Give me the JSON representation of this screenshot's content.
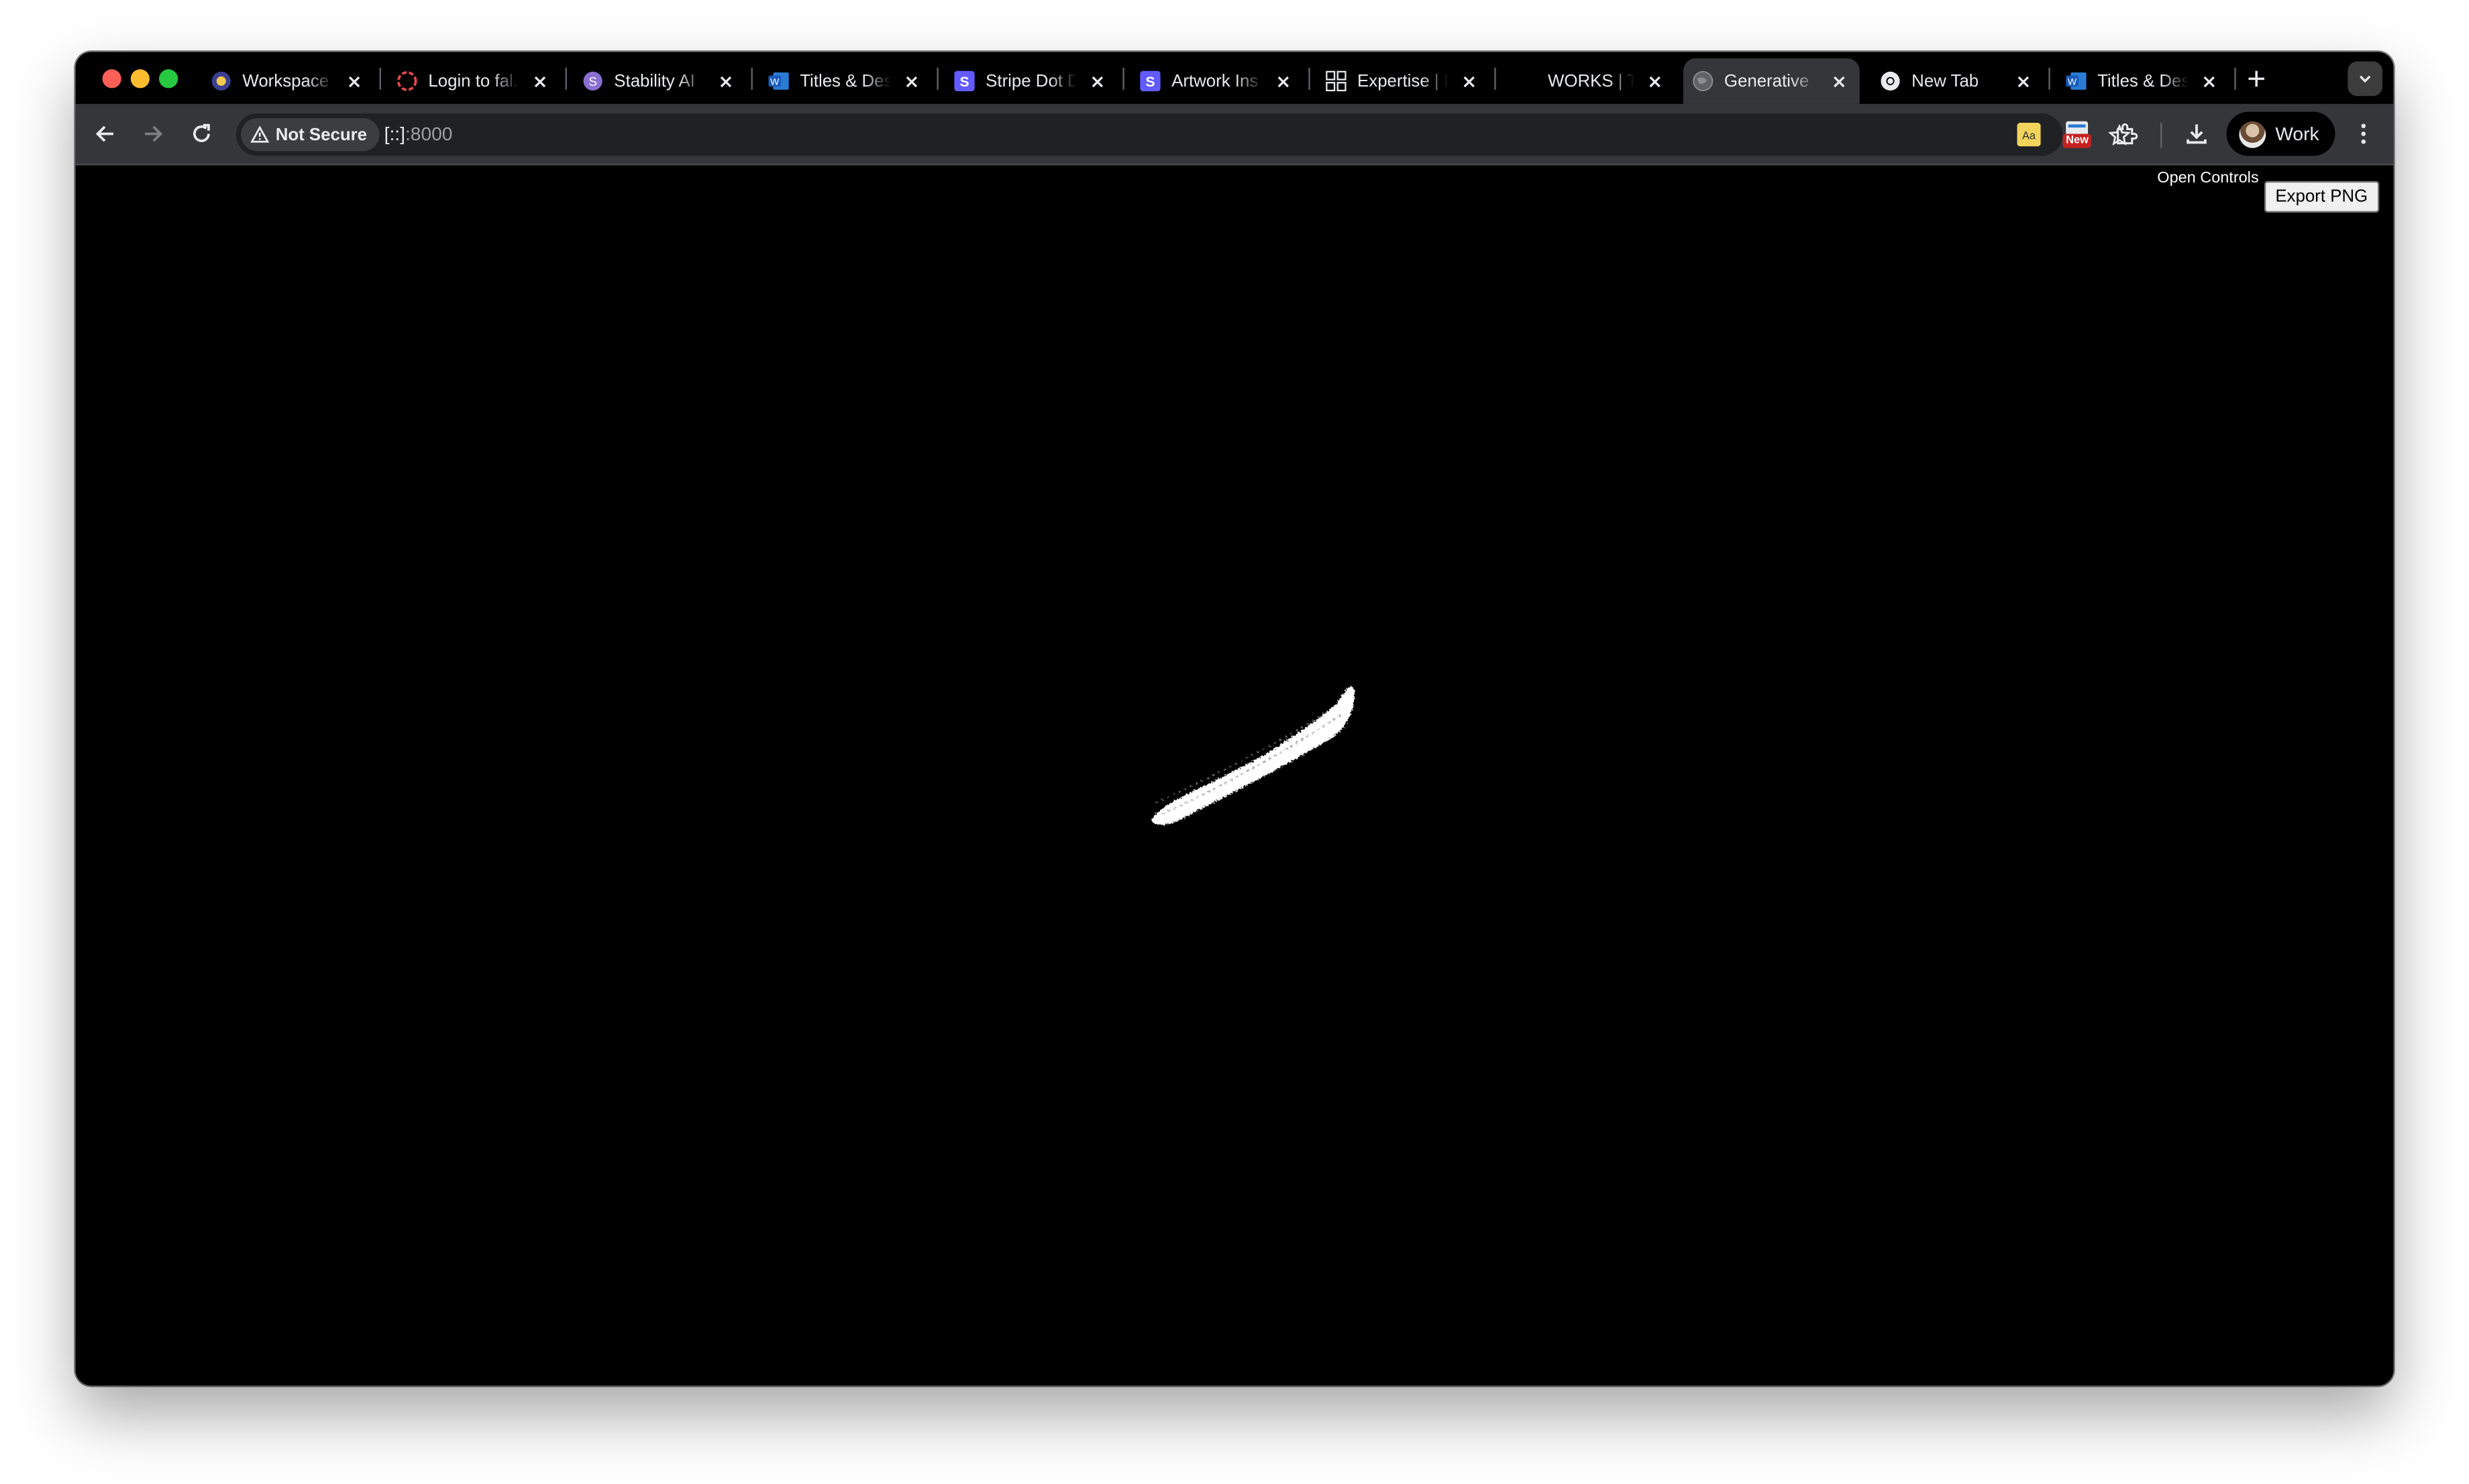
{
  "tabs": [
    {
      "title": "Workspace",
      "icon": "workspace-icon"
    },
    {
      "title": "Login to fal.",
      "icon": "fal-icon"
    },
    {
      "title": "Stability AI",
      "icon": "stability-icon"
    },
    {
      "title": "Titles & Des",
      "icon": "word-icon"
    },
    {
      "title": "Stripe Dot D",
      "icon": "stripe-icon"
    },
    {
      "title": "Artwork Ins",
      "icon": "stripe-icon"
    },
    {
      "title": "Expertise | I",
      "icon": "grid-icon"
    },
    {
      "title": "WORKS | TI",
      "icon": "blank-icon"
    },
    {
      "title": "Generative",
      "icon": "globe-icon",
      "active": true
    },
    {
      "title": "New Tab",
      "icon": "chrome-icon"
    },
    {
      "title": "Titles & Des",
      "icon": "word-icon"
    }
  ],
  "toolbar": {
    "security_chip": "Not Secure",
    "url_host": "[::]",
    "url_port": ":8000",
    "ext_badge": "New",
    "profile_name": "Work"
  },
  "page": {
    "open_controls_label": "Open Controls",
    "export_button_label": "Export PNG",
    "canvas_background": "#000000",
    "stroke_color": "#ffffff"
  },
  "colors": {
    "tabstrip": "#000000",
    "toolbar": "#35363a",
    "omnibox": "#202124",
    "text": "#e8eaed"
  }
}
